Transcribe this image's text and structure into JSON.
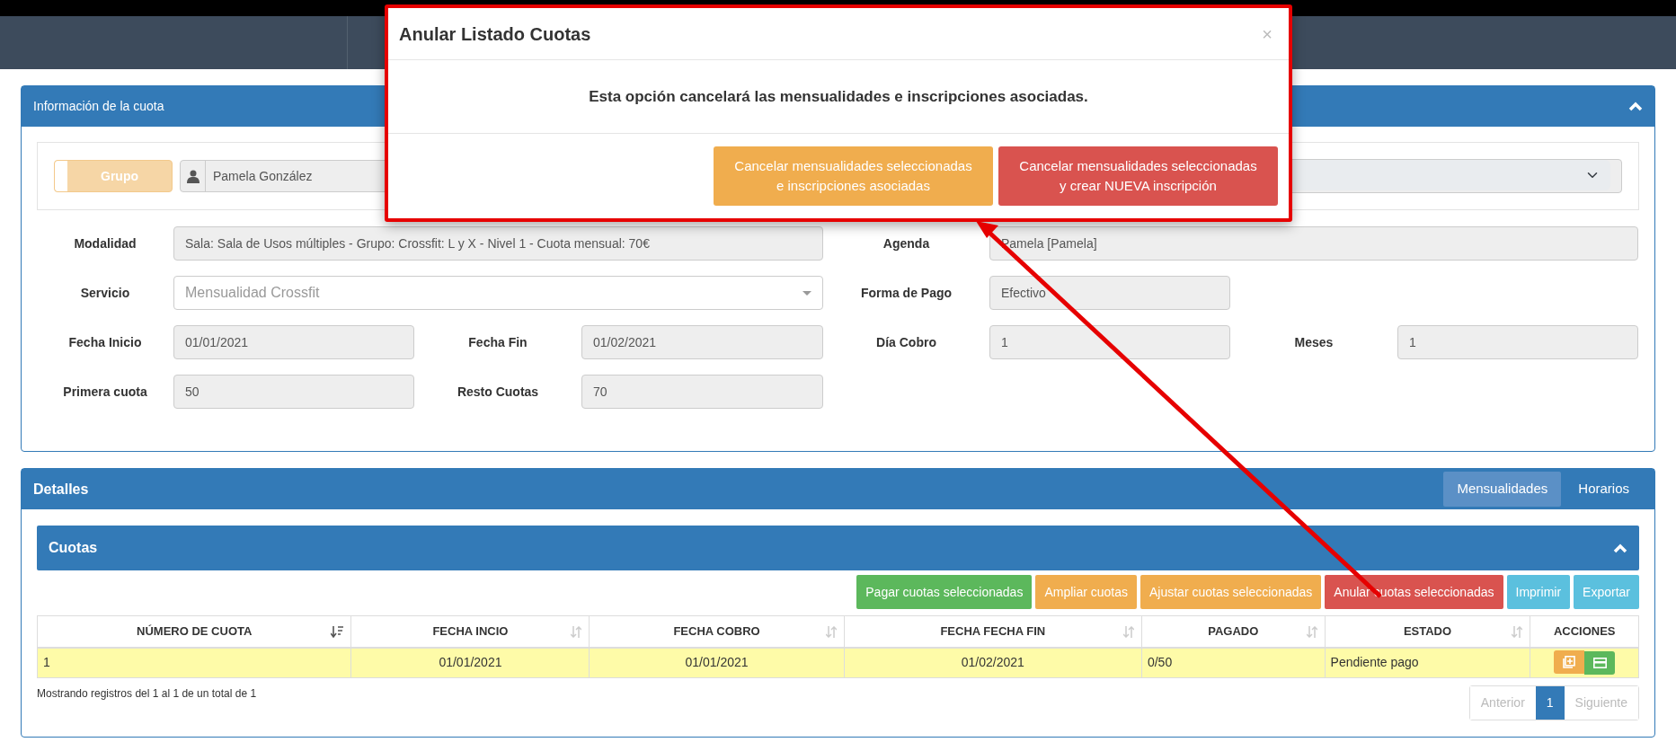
{
  "info_panel": {
    "title": "Información de la cuota",
    "group_toggle": {
      "label": "Grupo",
      "disabled": true
    },
    "person_field": {
      "value": "Pamela González"
    },
    "fields": [
      {
        "label": "Modalidad",
        "value": "Sala: Sala de Usos múltiples - Grupo: Crossfit: L y X - Nivel 1 - Cuota mensual: 70€",
        "kind": "text"
      },
      {
        "label": "Agenda",
        "value": "Pamela [Pamela]",
        "kind": "select"
      },
      {
        "label": "Servicio",
        "value": "Mensualidad Crossfit",
        "kind": "combo"
      },
      {
        "label": "Forma de Pago",
        "value": "Efectivo",
        "kind": "select"
      },
      {
        "label": "Fecha Inicio",
        "value": "01/01/2021",
        "kind": "text"
      },
      {
        "label": "Fecha Fin",
        "value": "01/02/2021",
        "kind": "text"
      },
      {
        "label": "Día Cobro",
        "value": "1",
        "kind": "text"
      },
      {
        "label": "Meses",
        "value": "1",
        "kind": "text"
      },
      {
        "label": "Primera cuota",
        "value": "50",
        "kind": "text"
      },
      {
        "label": "Resto Cuotas",
        "value": "70",
        "kind": "text"
      }
    ]
  },
  "details_panel": {
    "title": "Detalles",
    "tabs": [
      {
        "label": "Mensualidades",
        "selected": true
      },
      {
        "label": "Horarios",
        "selected": false
      }
    ],
    "cuotas": {
      "title": "Cuotas",
      "buttons": [
        {
          "label": "Pagar cuotas seleccionadas",
          "color": "#5cb85c"
        },
        {
          "label": "Ampliar cuotas",
          "color": "#f0ad4e"
        },
        {
          "label": "Ajustar cuotas seleccionadas",
          "color": "#f0ad4e"
        },
        {
          "label": "Anular cuotas seleccionadas",
          "color": "#d9534f"
        },
        {
          "label": "Imprimir",
          "color": "#5bc0de"
        },
        {
          "label": "Exportar",
          "color": "#5bc0de"
        }
      ],
      "table": {
        "columns": [
          {
            "label": "NÚMERO DE CUOTA",
            "sortable": true,
            "sorted": true
          },
          {
            "label": "FECHA INCIO",
            "sortable": true,
            "sorted": false
          },
          {
            "label": "FECHA COBRO",
            "sortable": true,
            "sorted": false
          },
          {
            "label": "FECHA FECHA FIN",
            "sortable": true,
            "sorted": false
          },
          {
            "label": "PAGADO",
            "sortable": true,
            "sorted": false
          },
          {
            "label": "ESTADO",
            "sortable": true,
            "sorted": false
          },
          {
            "label": "ACCIONES",
            "sortable": false
          }
        ],
        "rows": [
          {
            "cells": [
              "1",
              "01/01/2021",
              "01/01/2021",
              "01/02/2021",
              "0/50",
              "Pendiente pago"
            ],
            "selected": true
          }
        ]
      },
      "info_text": "Mostrando registros del 1 al 1 de un total de 1",
      "pagination": {
        "previous": {
          "label": "Anterior",
          "disabled": true
        },
        "pages": [
          {
            "label": "1",
            "selected": true
          }
        ],
        "next": {
          "label": "Siguiente",
          "disabled": true
        }
      }
    }
  },
  "modal": {
    "title": "Anular Listado Cuotas",
    "close": "×",
    "message": "Esta opción cancelará las mensualidades e inscripciones asociadas.",
    "buttons": [
      {
        "lines": [
          "Cancelar mensualidades seleccionadas",
          "e inscripciones asociadas"
        ],
        "color": "#f0ad4e"
      },
      {
        "lines": [
          "Cancelar mensualidades seleccionadas",
          "y crear NUEVA inscripción"
        ],
        "color": "#d9534f"
      }
    ]
  }
}
